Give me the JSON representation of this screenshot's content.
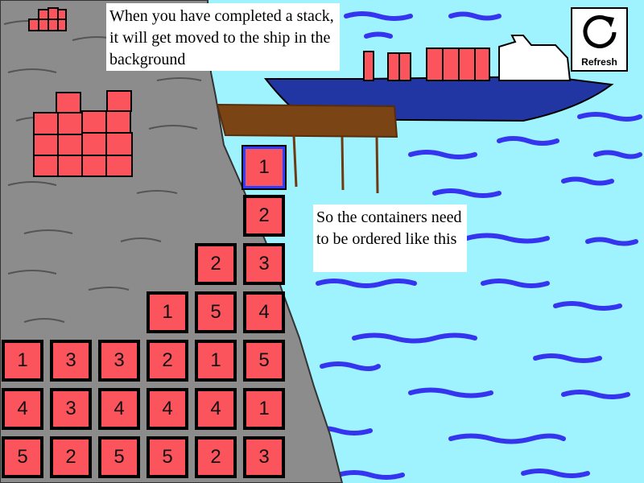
{
  "tips": {
    "ship_tip": "When you have completed a stack, it will get moved to the ship in the background",
    "order_tip": "So the containers need to be ordered like this"
  },
  "refresh": {
    "label": "Refresh",
    "icon": "refresh-icon"
  },
  "colors": {
    "sea": "#9ff3ff",
    "rock": "#8c8c8c",
    "container": "#fb545d",
    "ship_hull": "#2236a3",
    "selected": "#2b3fff",
    "wave": "#3535f0",
    "pier": "#7a4414"
  },
  "board": {
    "columns": [
      {
        "tiles": [
          "1",
          "4",
          "5"
        ]
      },
      {
        "tiles": [
          "3",
          "3",
          "2"
        ]
      },
      {
        "tiles": [
          "3",
          "4",
          "5"
        ]
      },
      {
        "tiles": [
          "1",
          "2",
          "4",
          "5"
        ]
      },
      {
        "tiles": [
          "2",
          "5",
          "1",
          "4",
          "2"
        ]
      },
      {
        "tiles": [
          "1",
          "2",
          "3",
          "4",
          "5",
          "1",
          "3"
        ]
      }
    ],
    "selected_tile": {
      "column": 6,
      "position": 1
    }
  }
}
